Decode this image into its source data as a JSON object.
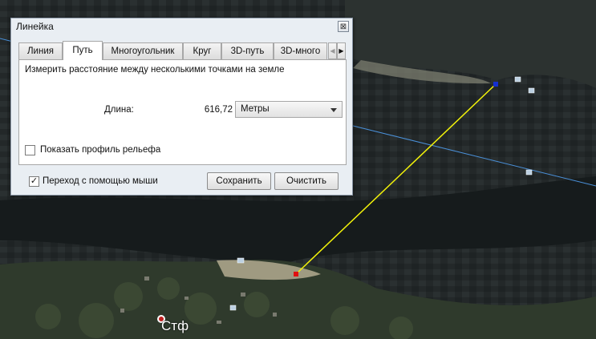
{
  "dialog": {
    "title": "Линейка",
    "close_glyph": "⊠",
    "tabs": [
      {
        "label": "Линия"
      },
      {
        "label": "Путь"
      },
      {
        "label": "Многоугольник"
      },
      {
        "label": "Круг"
      },
      {
        "label": "3D-путь"
      },
      {
        "label": "3D-много"
      }
    ],
    "active_tab": "Путь",
    "tab_scroll": {
      "left": "◀",
      "right": "▶"
    },
    "description": "Измерить расстояние между несколькими точками на земле",
    "length_label": "Длина:",
    "length_value": "616,72",
    "unit_select": {
      "selected": "Метры"
    },
    "show_elevation_profile": {
      "label": "Показать профиль рельефа",
      "checked": false
    },
    "mouse_navigation": {
      "label": "Переход с помощью мыши",
      "checked": true,
      "check_glyph": "✓"
    },
    "buttons": {
      "save": "Сохранить",
      "clear": "Очистить"
    }
  },
  "map": {
    "place_label": "Стф",
    "colors": {
      "path_line": "#f2f20a",
      "road_line": "#4a90d9",
      "start_point": "#e01010",
      "end_point": "#1530d0"
    }
  }
}
